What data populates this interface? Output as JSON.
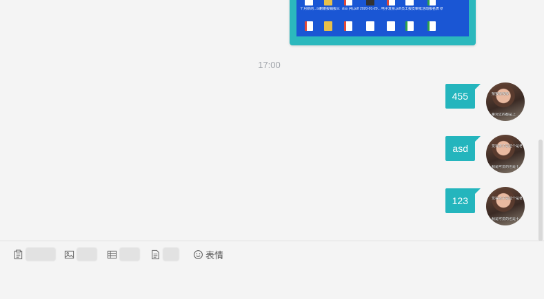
{
  "chat": {
    "timestamp": "17:00",
    "screenshot_labels_row1": [
      "个月新的...txt",
      "谢谢报销报三中 的汇报表...",
      "xlsx (4).pdf",
      "2020-01-20... .mp4",
      "电子发票.pdf",
      "员工报支审批 表-中州县...",
      "活动报名表 统计表.xlsx"
    ],
    "messages": [
      {
        "text": "455",
        "avatar_caption_1": "报报报报报",
        "avatar_caption_2": "量对过的都是上"
      },
      {
        "text": "asd",
        "avatar_caption_1": "觉得孩子是这个是老上",
        "avatar_caption_2": "我是可爱的也是十"
      },
      {
        "text": "123",
        "avatar_caption_1": "觉得孩子是这个是老上",
        "avatar_caption_2": "我是可爱的也是十"
      }
    ]
  },
  "toolbar": {
    "emoji_label": "表情"
  },
  "icons": {
    "tool1": "clipboard-icon",
    "tool2": "image-icon",
    "tool3": "table-icon",
    "tool4": "document-icon",
    "tool5": "smiley-icon"
  },
  "colors": {
    "bubble": "#24b5bd",
    "background": "#f4f4f4"
  }
}
